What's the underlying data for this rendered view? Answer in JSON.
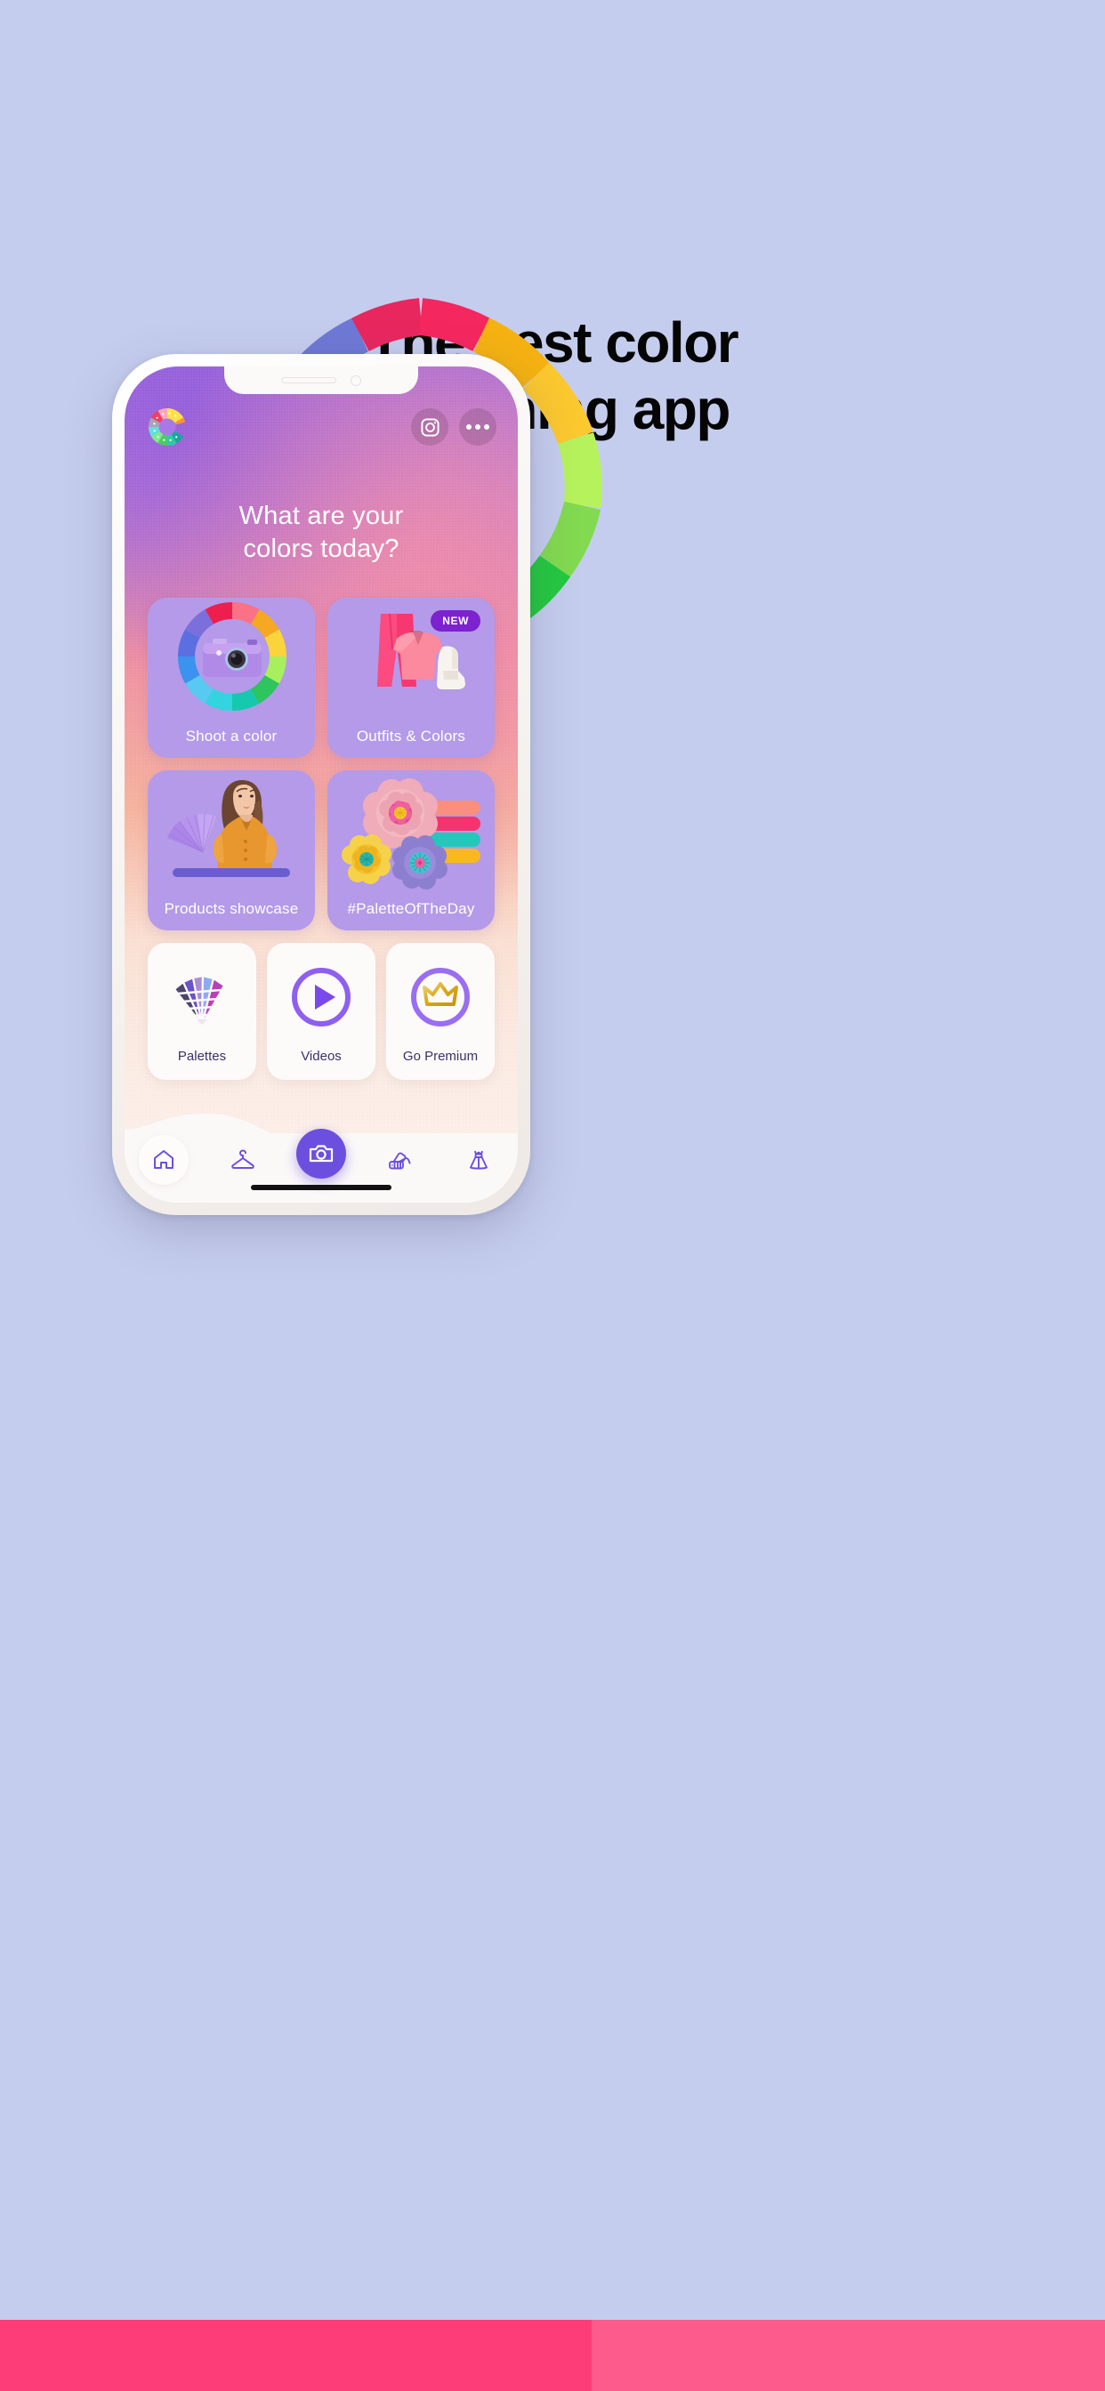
{
  "page": {
    "background_color": "#c5cdee",
    "headline_line1": "The best color",
    "headline_line2": "matching app"
  },
  "bottom_band": {
    "left_color": "#fc3d77",
    "right_color": "#fc5b8b"
  },
  "color_arc": {
    "segments": [
      "#e8275e",
      "#f02a5f",
      "#f5b211",
      "#fbc82f",
      "#b6f25c",
      "#82da50",
      "#23c93f",
      "#19b6b0"
    ]
  },
  "phone": {
    "app_header": {
      "logo_name": "color-wheel-logo",
      "instagram_label": "Instagram",
      "more_label": "More options"
    },
    "hero": {
      "line1": "What are your",
      "line2": "colors today?"
    },
    "tiles": [
      {
        "id": "shoot-a-color",
        "label": "Shoot a color",
        "icon": "camera-color-wheel",
        "badge": null,
        "card_color": "#b49ae8"
      },
      {
        "id": "outfits-and-colors",
        "label": "Outfits & Colors",
        "icon": "outfit-clothes",
        "badge": "NEW",
        "badge_color": "#7c22ce",
        "card_color": "#b49ae8"
      },
      {
        "id": "products-showcase",
        "label": "Products showcase",
        "icon": "model-photo",
        "badge": null,
        "card_color": "#b49ae8"
      },
      {
        "id": "palette-of-the-day",
        "label": "#PaletteOfTheDay",
        "icon": "paper-flowers",
        "badge": null,
        "card_color": "#b49ae8"
      }
    ],
    "cards": [
      {
        "id": "palettes",
        "label": "Palettes",
        "icon": "swatch-fan-icon"
      },
      {
        "id": "videos",
        "label": "Videos",
        "icon": "play-circle-icon"
      },
      {
        "id": "go-premium",
        "label": "Go Premium",
        "icon": "crown-circle-icon"
      }
    ],
    "nav": [
      {
        "id": "home",
        "icon": "home-icon",
        "active": true
      },
      {
        "id": "wardrobe",
        "icon": "hanger-icon",
        "active": false
      },
      {
        "id": "camera",
        "icon": "camera-icon",
        "active": false,
        "primary": true
      },
      {
        "id": "palettes",
        "icon": "palette-fan-icon",
        "active": false
      },
      {
        "id": "outfits",
        "icon": "dress-icon",
        "active": false
      }
    ],
    "theme": {
      "accent_purple": "#6d4fe0",
      "tile_purple": "#b49ae8",
      "label_text": "#3b3266"
    }
  }
}
